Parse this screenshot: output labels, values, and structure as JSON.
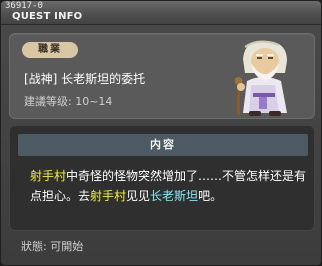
{
  "window": {
    "quest_id": "36917-0",
    "title": "QUEST INFO"
  },
  "quest": {
    "job_badge": "職業",
    "name": "[战神] 长老斯坦的委托",
    "level": "建議等级: 10~14"
  },
  "content": {
    "header": "内容",
    "segments": [
      {
        "text": "射手村",
        "style": "yellow"
      },
      {
        "text": "中奇怪的怪物突然增加了……不管怎样还是有点担心。去",
        "style": "plain"
      },
      {
        "text": "射手村",
        "style": "yellow"
      },
      {
        "text": "见见",
        "style": "plain"
      },
      {
        "text": "长老斯坦",
        "style": "cyan"
      },
      {
        "text": "吧。",
        "style": "plain"
      }
    ]
  },
  "status": {
    "text": "狀態: 可開始"
  },
  "colors": {
    "highlight_place": "#f4ec4a",
    "highlight_npc": "#87e8f7",
    "badge_bg": "#d9c6a4",
    "content_header_bg": "#4b5a63"
  },
  "icons": {
    "npc_portrait": "elder-stan-portrait"
  }
}
